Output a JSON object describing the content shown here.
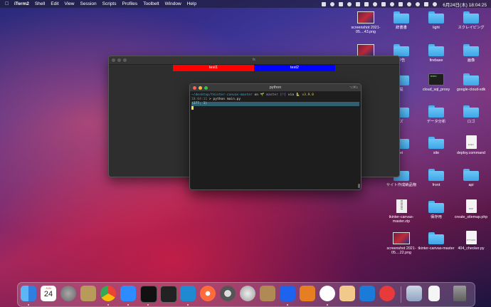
{
  "menubar": {
    "items": [
      "iTerm2",
      "Shell",
      "Edit",
      "View",
      "Session",
      "Scripts",
      "Profiles",
      "Toolbelt",
      "Window",
      "Help"
    ],
    "clock": "6月24日(木) 18:04:25"
  },
  "tk_window": {
    "title": "tk",
    "button1": "test1",
    "button2": "test2",
    "colors": {
      "button1": "#ff0000",
      "button2": "#0000ff"
    }
  },
  "iterm_window": {
    "title": "python",
    "shortcut": "⌥⌘1",
    "line1": {
      "path": "~/desktop/tkinter-canvas-master",
      "on": " on ",
      "branch": "🌱 master [!]",
      "via": " via ",
      "version": "🐍 v3.9.0"
    },
    "line2": {
      "time": "18:04:11",
      "prompt": " > ",
      "cmd": "python main.py"
    },
    "line3": "(277, 1)"
  },
  "desktop_icons": [
    {
      "label": "screenshot 2021-05....43.png",
      "kind": "shot"
    },
    {
      "label": "辞書書",
      "kind": "folder"
    },
    {
      "label": "light",
      "kind": "folder"
    },
    {
      "label": "スクレイピング",
      "kind": "folder"
    },
    {
      "label": "",
      "kind": "shot"
    },
    {
      "label": "中告",
      "kind": "folder"
    },
    {
      "label": "firebase",
      "kind": "folder"
    },
    {
      "label": "画像",
      "kind": "folder"
    },
    {
      "label": "提",
      "kind": "folder"
    },
    {
      "label": "cloud_sql_proxy",
      "kind": "term"
    },
    {
      "label": "google-cloud-sdk",
      "kind": "folder"
    },
    {
      "label": "ズ",
      "kind": "folder"
    },
    {
      "label": "データ分析",
      "kind": "folder"
    },
    {
      "label": "ロゴ",
      "kind": "folder"
    },
    {
      "label": "ei",
      "kind": "folder"
    },
    {
      "label": "site",
      "kind": "folder"
    },
    {
      "label": "deploy.command",
      "kind": "doc"
    },
    {
      "label": "サイト作成納品物",
      "kind": "folder"
    },
    {
      "label": "front",
      "kind": "folder"
    },
    {
      "label": "api",
      "kind": "folder"
    },
    {
      "label": "tkinter-canvas-master.zip",
      "kind": "zip"
    },
    {
      "label": "保存用",
      "kind": "folder"
    },
    {
      "label": "create_sitemap.php",
      "kind": "doc"
    },
    {
      "label": "screenshot 2021-05....22.png",
      "kind": "shot"
    },
    {
      "label": "tkinter-canvas-master",
      "kind": "folder"
    },
    {
      "label": "404_checker.py",
      "kind": "doc"
    }
  ],
  "dock": {
    "calendar_day": "24",
    "calendar_month": "JUN",
    "apps": [
      "finder",
      "calendar",
      "system-preferences",
      "keychain",
      "chrome",
      "zoom",
      "iterm",
      "terminal",
      "vscode",
      "safari",
      "quicktime",
      "sequel-ace",
      "archive",
      "docker",
      "sourcetree",
      "proxyman",
      "preview",
      "xcode-tool",
      "infinity",
      "clock",
      "screenshot-folder",
      "document",
      "trash"
    ]
  }
}
